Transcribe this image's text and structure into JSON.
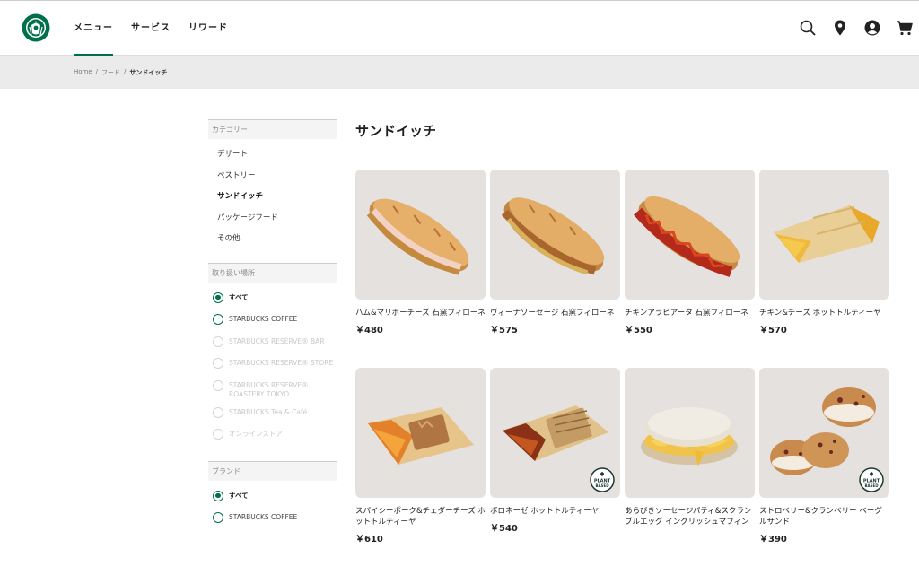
{
  "header": {
    "nav": [
      {
        "label": "メニュー",
        "active": true
      },
      {
        "label": "サービス",
        "active": false
      },
      {
        "label": "リワード",
        "active": false
      }
    ],
    "icons": [
      "search-icon",
      "location-pin-icon",
      "account-icon",
      "cart-icon"
    ],
    "brand_color": "#00704a"
  },
  "breadcrumb": [
    "Home",
    "/",
    "フード",
    "/",
    "サンドイッチ"
  ],
  "sidebar": {
    "category_heading": "カテゴリー",
    "categories": [
      {
        "label": "デザート",
        "active": false
      },
      {
        "label": "ペストリー",
        "active": false
      },
      {
        "label": "サンドイッチ",
        "active": true
      },
      {
        "label": "パッケージフード",
        "active": false
      },
      {
        "label": "その他",
        "active": false
      }
    ],
    "location_heading": "取り扱い場所",
    "locations": [
      {
        "label": "すべて",
        "state": "checked"
      },
      {
        "label": "STARBUCKS COFFEE",
        "state": "normal"
      },
      {
        "label": "STARBUCKS RESERVE® BAR",
        "state": "disabled"
      },
      {
        "label": "STARBUCKS RESERVE® STORE",
        "state": "disabled"
      },
      {
        "label": "STARBUCKS RESERVE® ROASTERY TOKYO",
        "state": "disabled"
      },
      {
        "label": "STARBUCKS Tea & Café",
        "state": "disabled"
      },
      {
        "label": "オンラインストア",
        "state": "disabled"
      }
    ],
    "brand_heading": "ブランド",
    "brands": [
      {
        "label": "すべて",
        "state": "checked"
      },
      {
        "label": "STARBUCKS COFFEE",
        "state": "normal"
      }
    ]
  },
  "main": {
    "title": "サンドイッチ",
    "products": [
      {
        "name": "ハム&マリボーチーズ 石窯フィローネ",
        "price": "￥480",
        "plant": false,
        "kind": "baguette-ham"
      },
      {
        "name": "ヴィーナソーセージ 石窯フィローネ",
        "price": "￥575",
        "plant": false,
        "kind": "baguette-sausage"
      },
      {
        "name": "チキンアラビアータ 石窯フィローネ",
        "price": "￥550",
        "plant": false,
        "kind": "baguette-red"
      },
      {
        "name": "チキン&チーズ ホットトルティーヤ",
        "price": "￥570",
        "plant": false,
        "kind": "tortilla-yellow"
      },
      {
        "name": "スパイシーポーク&チェダーチーズ ホットトルティーヤ",
        "price": "￥610",
        "plant": false,
        "kind": "tortilla-orange"
      },
      {
        "name": "ボロネーゼ ホットトルティーヤ",
        "price": "￥540",
        "plant": true,
        "kind": "tortilla-brown"
      },
      {
        "name": "あらびきソーセージパティ&スクランブルエッグ イングリッシュマフィン",
        "price": "",
        "plant": false,
        "kind": "muffin"
      },
      {
        "name": "ストロベリー&クランベリー ベーグルサンド",
        "price": "￥390",
        "plant": true,
        "kind": "bagel"
      }
    ],
    "plant_badge": [
      "PLANT",
      "BASED"
    ]
  }
}
